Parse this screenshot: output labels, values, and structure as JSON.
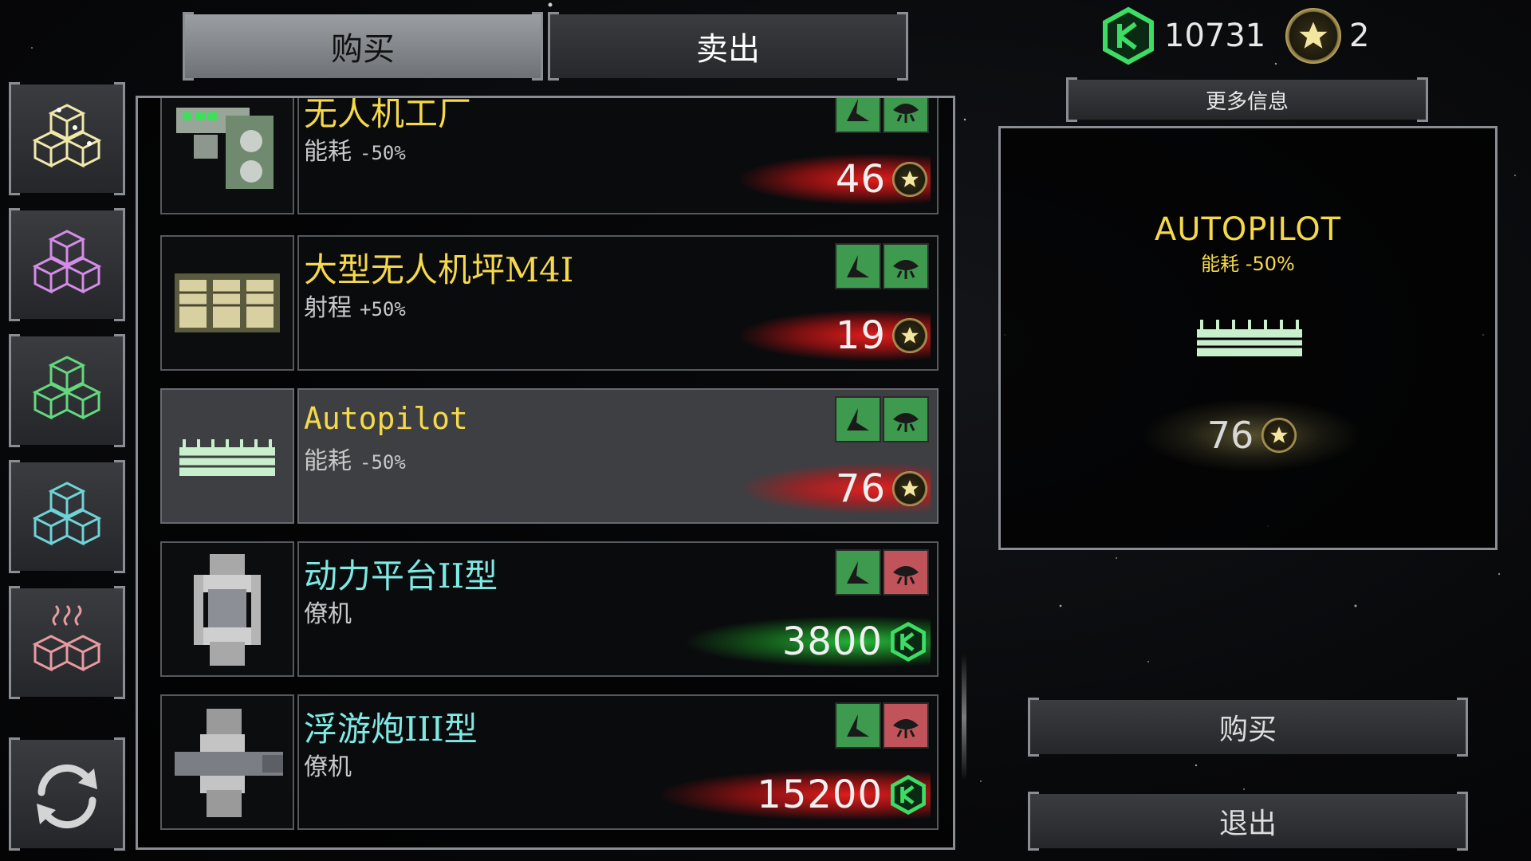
{
  "tabs": {
    "buy": "购买",
    "sell": "卖出"
  },
  "currency": {
    "credits": "10731",
    "stars": "2"
  },
  "more_info_label": "更多信息",
  "side_buttons": [
    "modules-all-icon",
    "modules-purple-icon",
    "modules-green-icon",
    "modules-teal-icon",
    "modules-heat-icon",
    "refresh-icon"
  ],
  "items": [
    {
      "name": "无人机工厂",
      "stat_label": "能耗",
      "stat_value": "-50%",
      "price": "46",
      "price_currency": "star",
      "price_glow": "red",
      "name_color": "yellow",
      "icon2_color": "green"
    },
    {
      "name": "大型无人机坪M4I",
      "stat_label": "射程",
      "stat_value": "+50%",
      "price": "19",
      "price_currency": "star",
      "price_glow": "red",
      "name_color": "yellow",
      "icon2_color": "green"
    },
    {
      "name": "Autopilot",
      "stat_label": "能耗",
      "stat_value": "-50%",
      "price": "76",
      "price_currency": "star",
      "price_glow": "red",
      "name_color": "yellow",
      "icon2_color": "green",
      "selected": true
    },
    {
      "name": "动力平台II型",
      "stat_label": "僚机",
      "stat_value": "",
      "price": "3800",
      "price_currency": "credit",
      "price_glow": "green",
      "name_color": "cyan",
      "icon2_color": "red"
    },
    {
      "name": "浮游炮III型",
      "stat_label": "僚机",
      "stat_value": "",
      "price": "15200",
      "price_currency": "credit",
      "price_glow": "red",
      "name_color": "cyan",
      "icon2_color": "red"
    }
  ],
  "detail": {
    "title": "AUTOPILOT",
    "stat_label": "能耗",
    "stat_value": "-50%",
    "price": "76"
  },
  "actions": {
    "buy": "购买",
    "exit": "退出"
  },
  "colors": {
    "accent_yellow": "#f5d94a",
    "accent_cyan": "#7fe9e4",
    "price_red": "#e81e1e",
    "price_green": "#28c83c",
    "credit_green": "#3ddc64"
  }
}
